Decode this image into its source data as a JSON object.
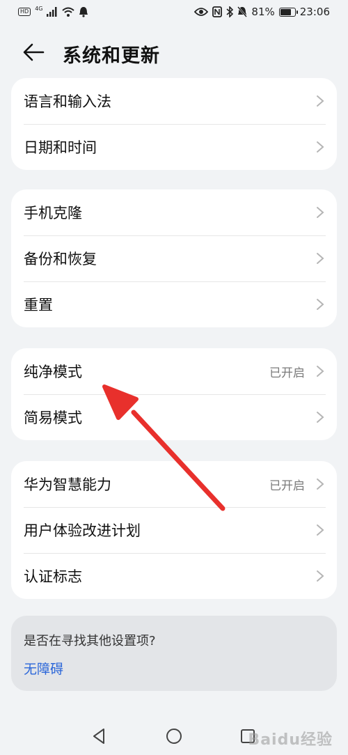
{
  "status_bar": {
    "hd_label": "HD",
    "network": "4G",
    "battery_percent": "81%",
    "battery_level": 0.81,
    "time": "23:06"
  },
  "header": {
    "title": "系统和更新"
  },
  "groups": [
    {
      "items": [
        {
          "label": "语言和输入法",
          "value": ""
        },
        {
          "label": "日期和时间",
          "value": ""
        }
      ]
    },
    {
      "items": [
        {
          "label": "手机克隆",
          "value": ""
        },
        {
          "label": "备份和恢复",
          "value": ""
        },
        {
          "label": "重置",
          "value": ""
        }
      ]
    },
    {
      "items": [
        {
          "label": "纯净模式",
          "value": "已开启"
        },
        {
          "label": "简易模式",
          "value": ""
        }
      ]
    },
    {
      "items": [
        {
          "label": "华为智慧能力",
          "value": "已开启"
        },
        {
          "label": "用户体验改进计划",
          "value": ""
        },
        {
          "label": "认证标志",
          "value": ""
        }
      ]
    }
  ],
  "suggestion": {
    "question": "是否在寻找其他设置项?",
    "link": "无障碍"
  },
  "watermark": "Baidu经验",
  "colors": {
    "background": "#f1f3f5",
    "card": "#ffffff",
    "link": "#2b66d9",
    "annotation_arrow": "#e8302c"
  }
}
